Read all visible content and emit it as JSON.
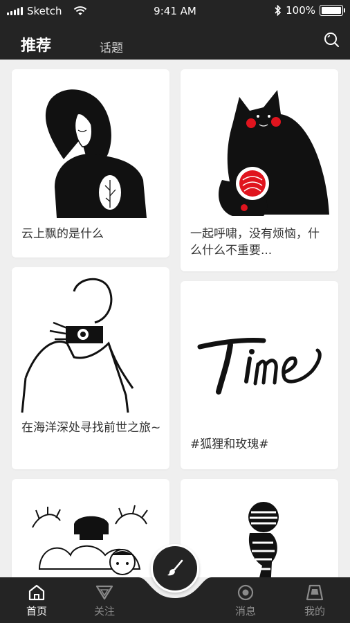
{
  "status_bar": {
    "carrier": "Sketch",
    "time": "9:41 AM",
    "battery": "100%",
    "icons": [
      "signal-icon",
      "wifi-icon",
      "bluetooth-icon",
      "battery-icon"
    ]
  },
  "header": {
    "tabs": [
      {
        "label": "推荐",
        "active": true
      },
      {
        "label": "话题",
        "active": false
      }
    ],
    "search_icon": "search-icon"
  },
  "feed": {
    "cards": [
      {
        "caption": "云上飘的是什么",
        "art": "girl-with-leaf-illustration"
      },
      {
        "caption": "一起呼啸，没有烦恼，什么什么不重要...",
        "art": "black-cats-illustration"
      },
      {
        "caption": "在海洋深处寻找前世之旅~",
        "art": "photographer-illustration"
      },
      {
        "caption": "#狐狸和玫瑰#",
        "art": "time-calligraphy"
      },
      {
        "caption": "",
        "art": "crowd-illustration"
      },
      {
        "caption": "",
        "art": "striped-figure-illustration"
      }
    ]
  },
  "bottom_nav": {
    "items": [
      {
        "label": "首页",
        "icon": "home-icon",
        "active": true
      },
      {
        "label": "关注",
        "icon": "triangle-follow-icon",
        "active": false
      },
      {
        "label": "消息",
        "icon": "message-circle-icon",
        "active": false
      },
      {
        "label": "我的",
        "icon": "profile-icon",
        "active": false
      }
    ],
    "fab_icon": "paint-brush-icon"
  },
  "colors": {
    "bar_background": "#242424",
    "page_background": "#efefef",
    "card_background": "#ffffff",
    "accent_red": "#e0141e"
  }
}
